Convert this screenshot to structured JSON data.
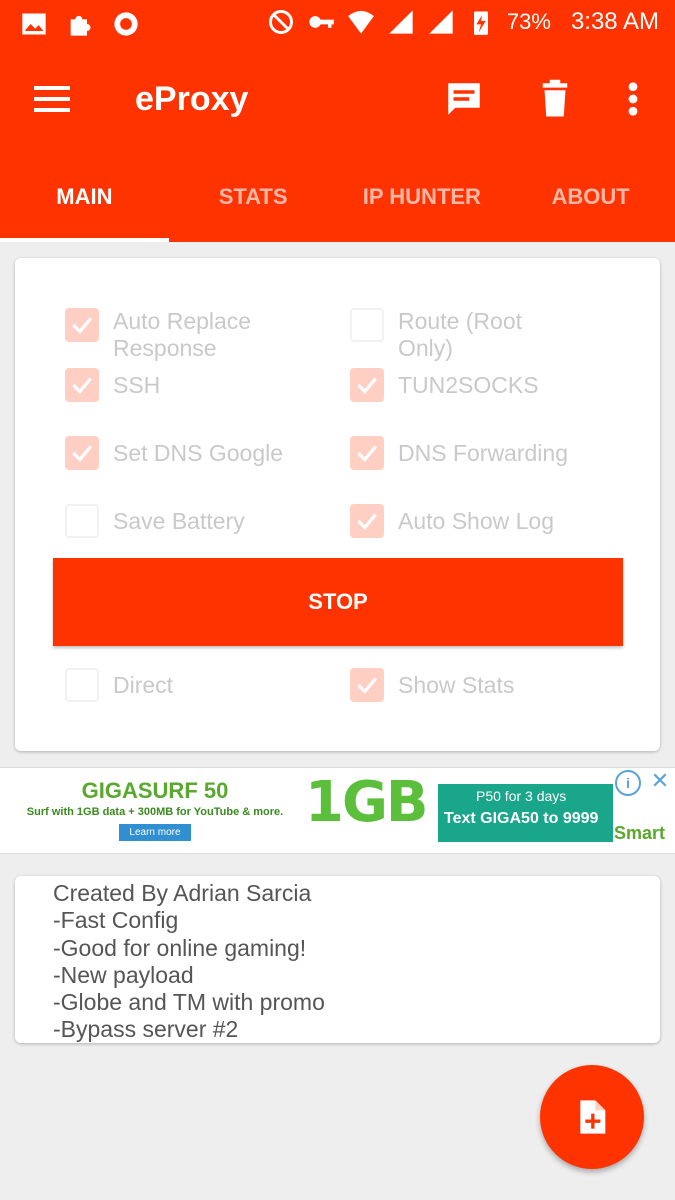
{
  "status_bar": {
    "battery": "73%",
    "time": "3:38 AM",
    "left_icons": [
      "image-icon",
      "puzzle-icon",
      "smiley-icon"
    ],
    "right_icons": [
      "do-not-disturb-icon",
      "key-icon",
      "wifi-icon",
      "signal-icon",
      "signal-icon",
      "battery-charging-icon"
    ]
  },
  "toolbar": {
    "title": "eProxy",
    "icons": [
      "menu-icon",
      "message-icon",
      "trash-icon",
      "more-vert-icon"
    ]
  },
  "tabs": [
    {
      "label": "MAIN",
      "active": true
    },
    {
      "label": "STATS",
      "active": false
    },
    {
      "label": "IP HUNTER",
      "active": false
    },
    {
      "label": "ABOUT",
      "active": false
    }
  ],
  "options": {
    "auto_replace": {
      "label": "Auto Replace Response",
      "checked": true
    },
    "route": {
      "label": "Route (Root Only)",
      "checked": false
    },
    "ssh": {
      "label": "SSH",
      "checked": true
    },
    "tun2socks": {
      "label": "TUN2SOCKS",
      "checked": true
    },
    "set_dns": {
      "label": "Set DNS Google",
      "checked": true
    },
    "dns_forwarding": {
      "label": "DNS Forwarding",
      "checked": true
    },
    "save_battery": {
      "label": "Save Battery",
      "checked": false
    },
    "auto_show_log": {
      "label": "Auto Show Log",
      "checked": true
    },
    "direct": {
      "label": "Direct",
      "checked": false
    },
    "show_stats": {
      "label": "Show Stats",
      "checked": true
    }
  },
  "stop_button": "STOP",
  "ad": {
    "title": "GIGASURF 50",
    "subtitle": "Surf with 1GB data + 300MB for YouTube & more.",
    "learn_more": "Learn more",
    "big": "1GB",
    "offer_line1": "P50 for 3 days",
    "offer_line2": "Text GIGA50 to 9999",
    "brand": "Smart",
    "info": "i",
    "close": "✕"
  },
  "config_notes": [
    "Created By Adrian Sarcia",
    "-Fast Config",
    "-Good for online gaming!",
    "-New payload",
    "-Globe and TM with promo",
    "-Bypass server #2"
  ],
  "fab": {
    "icon": "add-file-icon"
  }
}
